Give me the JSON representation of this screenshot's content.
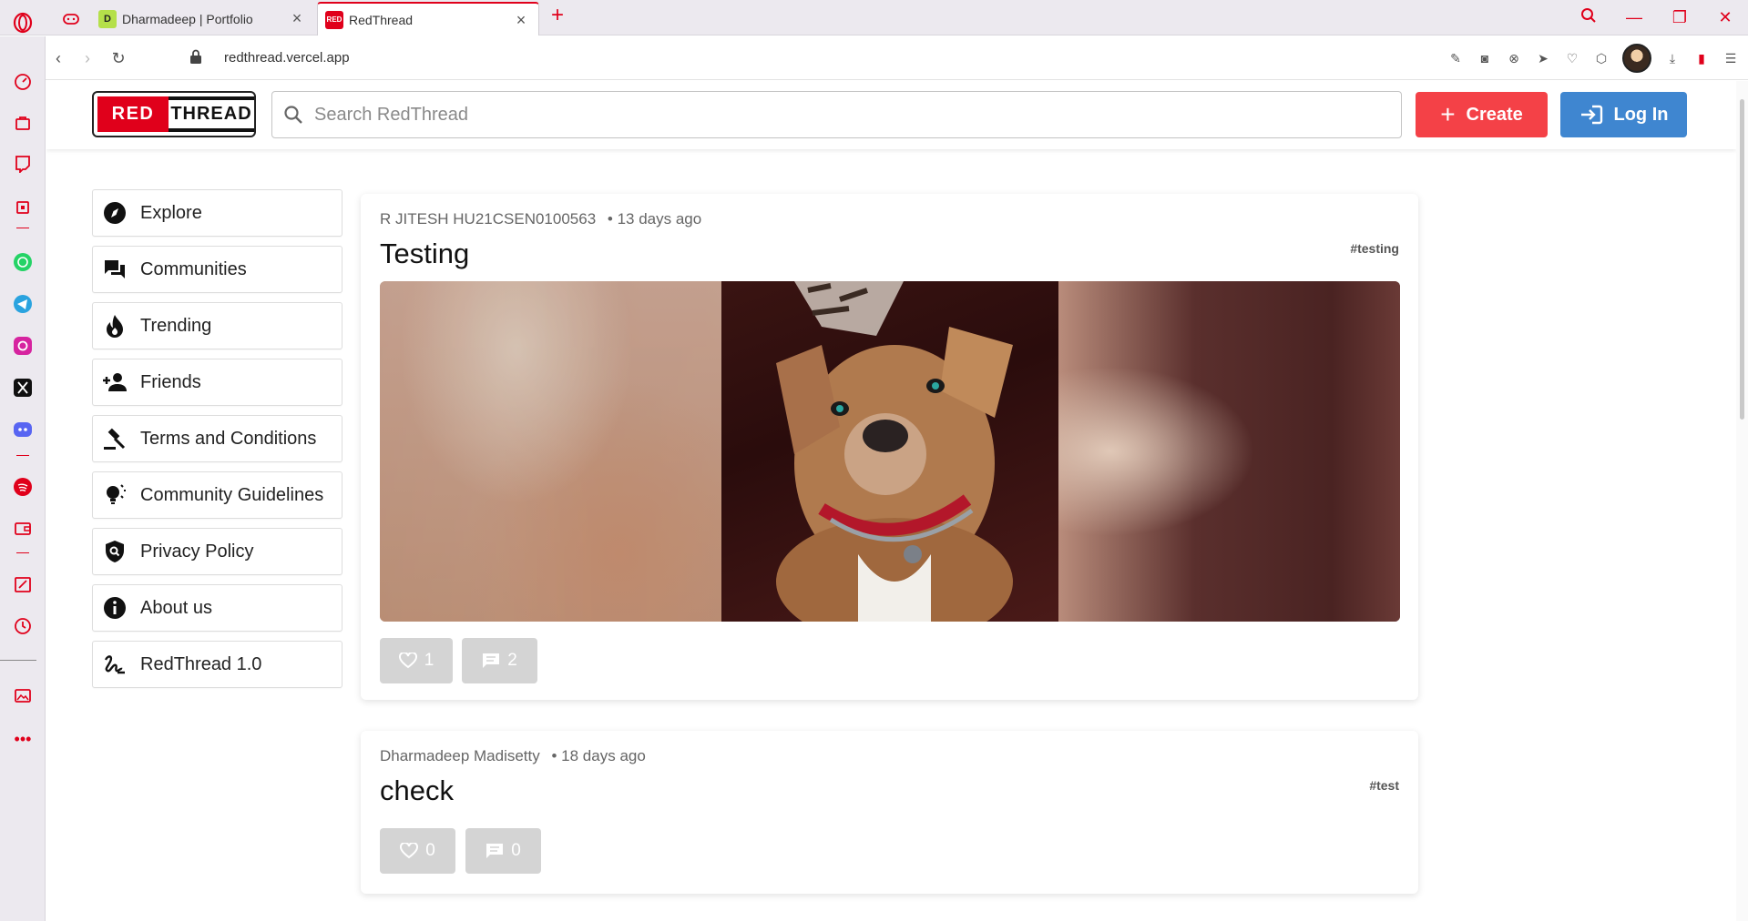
{
  "browser": {
    "tabs": [
      {
        "label": "Dharmadeep | Portfolio",
        "favicon_letter": "D"
      },
      {
        "label": "RedThread",
        "favicon_letter": "RED"
      }
    ],
    "url": "redthread.vercel.app"
  },
  "site": {
    "logo": {
      "part1": "RED",
      "part2": "THREAD"
    },
    "search_placeholder": "Search RedThread",
    "create_label": "Create",
    "login_label": "Log In"
  },
  "nav": {
    "items": [
      {
        "label": "Explore",
        "icon": "compass-icon"
      },
      {
        "label": "Communities",
        "icon": "forum-icon"
      },
      {
        "label": "Trending",
        "icon": "flame-icon"
      },
      {
        "label": "Friends",
        "icon": "person-add-icon"
      },
      {
        "label": "Terms and Conditions",
        "icon": "gavel-icon"
      },
      {
        "label": "Community Guidelines",
        "icon": "lightbulb-icon"
      },
      {
        "label": "Privacy Policy",
        "icon": "shield-icon"
      },
      {
        "label": "About us",
        "icon": "info-icon"
      },
      {
        "label": "RedThread 1.0",
        "icon": "signature-icon"
      }
    ]
  },
  "posts": [
    {
      "author": "R JITESH HU21CSEN0100563",
      "time": "• 13 days ago",
      "title": "Testing",
      "tag": "#testing",
      "likes": "1",
      "comments": "2"
    },
    {
      "author": "Dharmadeep Madisetty",
      "time": "• 18 days ago",
      "title": "check",
      "tag": "#test",
      "likes": "0",
      "comments": "0"
    }
  ],
  "colors": {
    "brand_red": "#e0001b",
    "create_button": "#f44147",
    "login_button": "#3f86d0",
    "reaction_button": "#d4d4d4"
  }
}
